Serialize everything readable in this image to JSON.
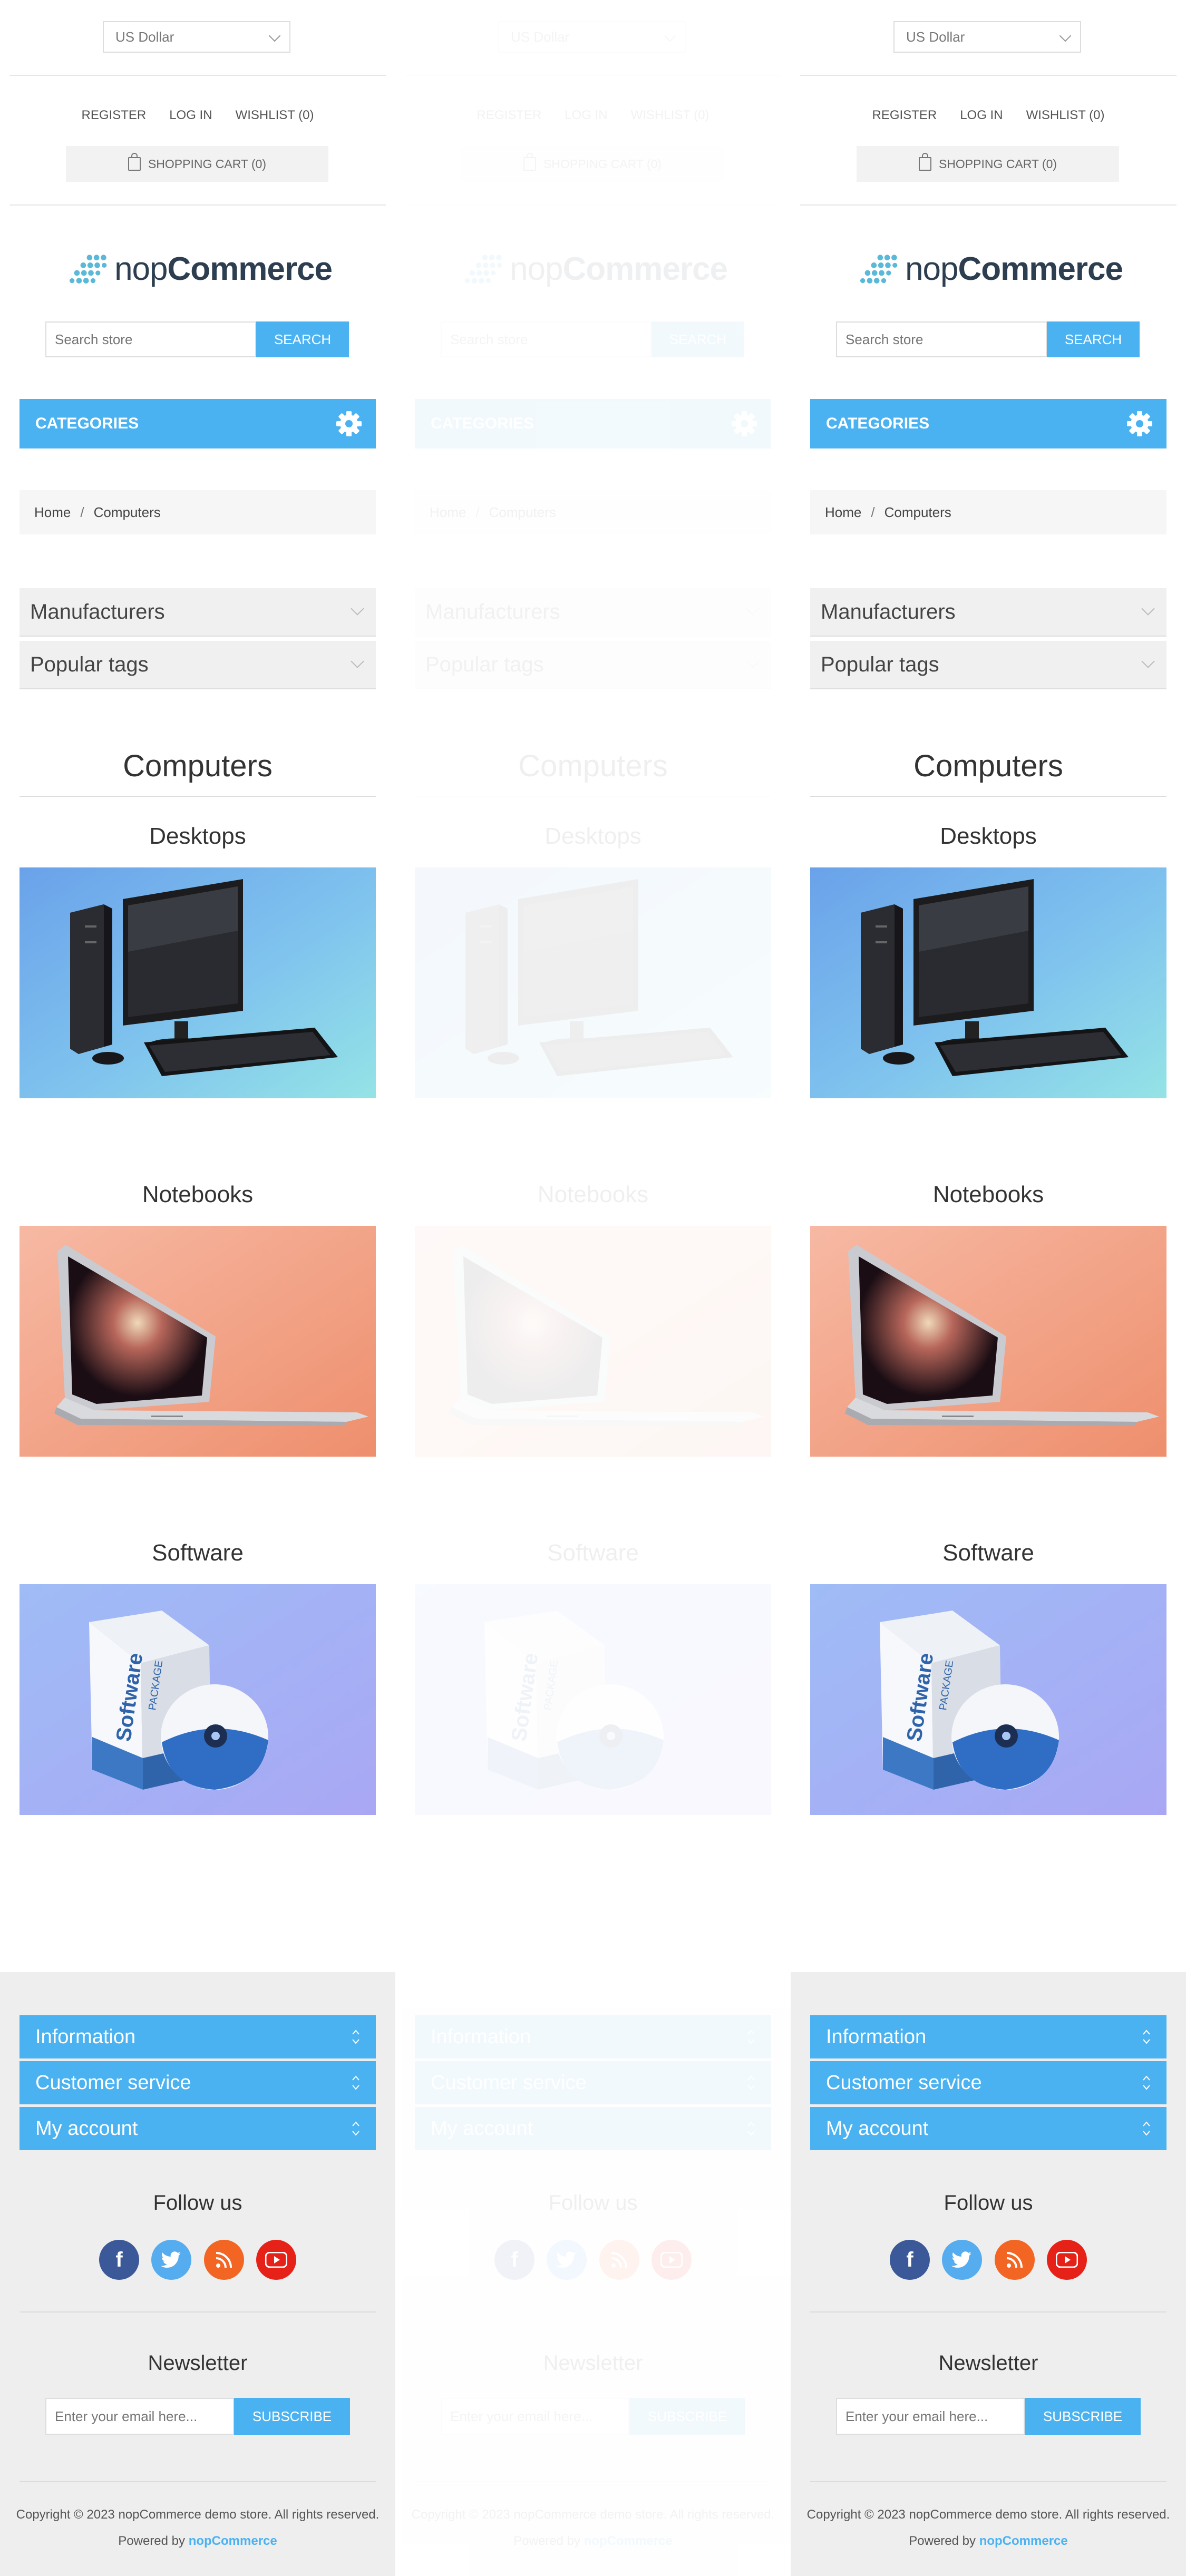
{
  "header": {
    "currency": "US Dollar",
    "register": "Register",
    "login": "Log in",
    "wishlist": "Wishlist (0)",
    "cart": "Shopping cart (0)"
  },
  "logo": {
    "light": "nop",
    "bold": "Commerce"
  },
  "search": {
    "placeholder": "Search store",
    "button": "Search"
  },
  "categories": {
    "label": "Categories"
  },
  "breadcrumb": {
    "home": "Home",
    "separator": "/",
    "current": "Computers"
  },
  "filters": {
    "manufacturers": "Manufacturers",
    "tags": "Popular tags"
  },
  "page": {
    "title": "Computers",
    "subcategories": [
      {
        "name": "Desktops"
      },
      {
        "name": "Notebooks"
      },
      {
        "name": "Software"
      }
    ]
  },
  "footer": {
    "blocks": [
      "Information",
      "Customer service",
      "My account"
    ],
    "follow": "Follow us",
    "newsletter": "Newsletter",
    "email_placeholder": "Enter your email here...",
    "subscribe": "Subscribe",
    "copyright": "Copyright © 2023 nopCommerce demo store. All rights reserved.",
    "powered_prefix": "Powered by",
    "powered_link": "nopCommerce"
  },
  "colors": {
    "accent": "#4ab2f1",
    "facebook": "#3b5998",
    "twitter": "#55acee",
    "rss": "#f26522",
    "youtube": "#e62117"
  }
}
